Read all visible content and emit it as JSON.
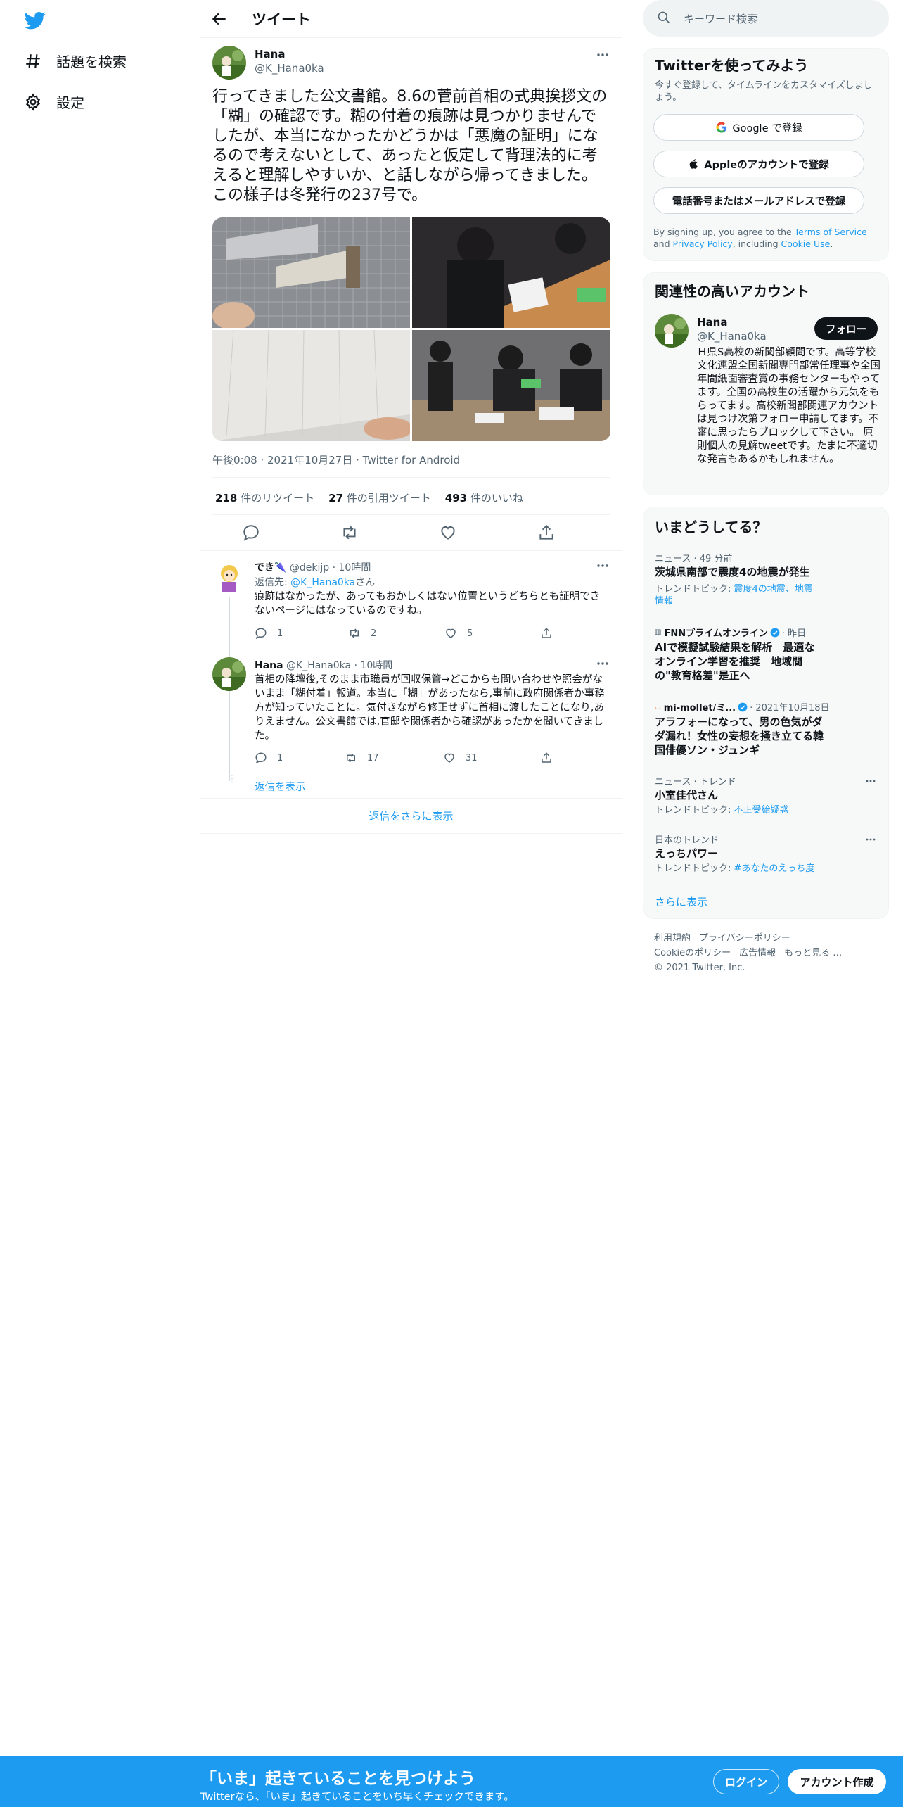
{
  "nav": {
    "logo": "twitter-logo",
    "items": [
      {
        "label": "話題を検索",
        "icon": "hashtag-icon"
      },
      {
        "label": "設定",
        "icon": "gear-icon"
      }
    ]
  },
  "header": {
    "title": "ツイート"
  },
  "tweet": {
    "name": "Hana",
    "handle": "@K_Hana0ka",
    "text": "行ってきました公文書館。8.6の菅前首相の式典挨拶文の「糊」の確認です。糊の付着の痕跡は見つかりませんでしたが、本当になかったかどうかは「悪魔の証明」になるので考えないとして、あったと仮定して背理法的に考えると理解しやすいか、と話しながら帰ってきました。この様子は冬発行の237号で。",
    "meta": "午後0:08 · 2021年10月27日 · Twitter for Android",
    "stats": [
      {
        "count": "218",
        "label": "件のリツイート"
      },
      {
        "count": "27",
        "label": "件の引用ツイート"
      },
      {
        "count": "493",
        "label": "件のいいね"
      }
    ]
  },
  "replies": [
    {
      "name": "でき🌂",
      "handle": "@dekijp",
      "time": "· 10時間",
      "reply_to_prefix": "返信先: ",
      "reply_to_handle": "@K_Hana0ka",
      "reply_to_suffix": "さん",
      "text": "痕跡はなかったが、あってもおかしくはない位置というどちらとも証明できないページにはなっているのですね。",
      "counts": {
        "reply": "1",
        "retweet": "2",
        "like": "5"
      }
    },
    {
      "name": "Hana",
      "handle": "@K_Hana0ka",
      "time": "· 10時間",
      "text": "首相の降壇後,そのまま市職員が回収保管→どこからも問い合わせや照会がないまま「糊付着」報道。本当に「糊」があったなら,事前に政府関係者か事務方が知っていたことに。気付きながら修正せずに首相に渡したことになり,ありえません。公文書館では,官邸や関係者から確認があったかを聞いてきました。",
      "counts": {
        "reply": "1",
        "retweet": "17",
        "like": "31"
      }
    }
  ],
  "show_replies": "返信を表示",
  "more_replies": "返信をさらに表示",
  "search": {
    "placeholder": "キーワード検索"
  },
  "signup": {
    "title": "Twitterを使ってみよう",
    "desc": "今すぐ登録して、タイムラインをカスタマイズしましょう。",
    "google": "Google で登録",
    "apple": "Appleのアカウントで登録",
    "phone": "電話番号またはメールアドレスで登録",
    "terms_pre": "By signing up, you agree to the ",
    "terms_tos": "Terms of Service",
    "terms_and": " and ",
    "terms_privacy": "Privacy Policy",
    "terms_incl": ", including ",
    "terms_cookie": "Cookie Use",
    "terms_end": "."
  },
  "related": {
    "title": "関連性の高いアカウント",
    "name": "Hana",
    "handle": "@K_Hana0ka",
    "follow": "フォロー",
    "bio": "Ｈ県S高校の新聞部顧問です。高等学校文化連盟全国新聞専門部常任理事や全国年間紙面審査賞の事務センターもやってます。全国の高校生の活躍から元気をもらってます。高校新聞部関連アカウントは見つけ次第フォロー申請してます。不審に思ったらブロックして下さい。 原則個人の見解tweetです。たまに不適切な発言もあるかもしれません。"
  },
  "trends": {
    "title": "いまどうしてる？",
    "items": [
      {
        "category": "ニュース · 49 分前",
        "name": "茨城県南部で震度4の地震が発生",
        "topic_label": "トレンドトピック: ",
        "topic": "震度4の地震、地震情報"
      },
      {
        "category": "FNNプライムオンライン",
        "time": "· 昨日",
        "name": "AIで模擬試験結果を解析　最適なオンライン学習を推奨　地域間の\"教育格差\"是正へ"
      },
      {
        "category": "mi-mollet/ミ...",
        "time": "· 2021年10月18日",
        "name": "アラフォーになって、男の色気がダダ漏れ！女性の妄想を掻き立てる韓国俳優ソン・ジュンギ"
      },
      {
        "category": "ニュース · トレンド",
        "name": "小室佳代さん",
        "topic_label": "トレンドトピック: ",
        "topic": "不正受給疑惑"
      },
      {
        "category": "日本のトレンド",
        "name": "えっちパワー",
        "topic_label": "トレンドトピック: ",
        "topic": "#あなたのえっち度"
      }
    ],
    "show_more": "さらに表示"
  },
  "footer": {
    "links": [
      "利用規約",
      "プライバシーポリシー",
      "Cookieのポリシー",
      "広告情報",
      "もっと見る …"
    ],
    "copyright": "© 2021 Twitter, Inc."
  },
  "banner": {
    "title": "「いま」起きていることを見つけよう",
    "subtitle": "Twitterなら、「いま」起きていることをいち早くチェックできます。",
    "login": "ログイン",
    "signup": "アカウント作成"
  },
  "colors": {
    "accent": "#1d9bf0",
    "text": "#0f1419",
    "muted": "#536471"
  }
}
